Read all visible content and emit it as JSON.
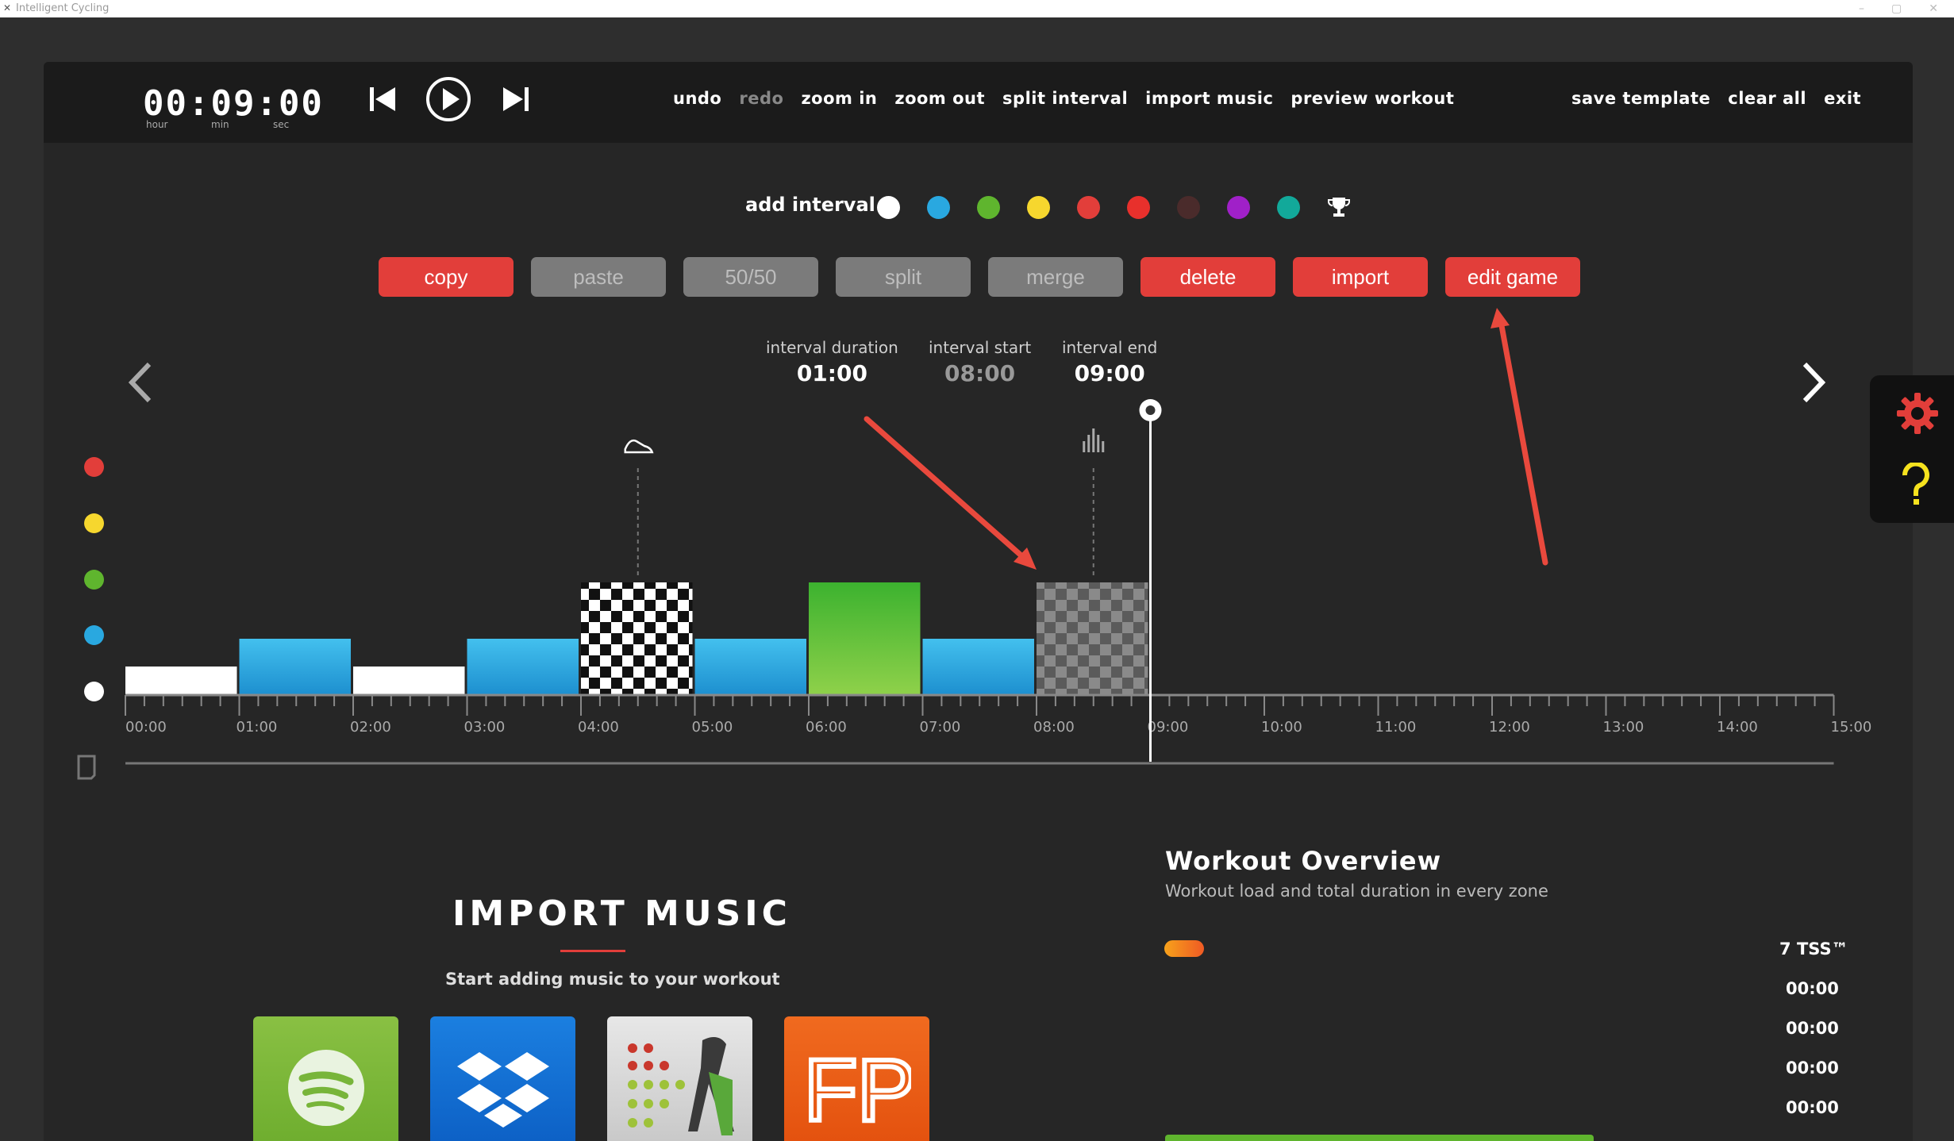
{
  "window": {
    "title": "Intelligent Cycling"
  },
  "timer": {
    "value": "00:09:00",
    "labels": [
      "hour",
      "min",
      "sec"
    ]
  },
  "menu": {
    "undo": "undo",
    "redo": "redo",
    "zoom_in": "zoom in",
    "zoom_out": "zoom out",
    "split_interval": "split interval",
    "import_music": "import music",
    "preview_workout": "preview workout",
    "save_template": "save template",
    "clear_all": "clear all",
    "exit": "exit"
  },
  "add_interval": {
    "label": "add interval",
    "colors": [
      "#ffffff",
      "#29a8e0",
      "#5fb52e",
      "#f6d72e",
      "#e23e3a",
      "#e8302c",
      "#4a2b2b",
      "#a020c8",
      "#12a99a"
    ],
    "trophy_icon": "trophy-icon"
  },
  "buttons": {
    "copy": "copy",
    "paste": "paste",
    "fifty": "50/50",
    "split": "split",
    "merge": "merge",
    "delete": "delete",
    "import": "import",
    "edit_game": "edit game"
  },
  "interval_info": {
    "duration_label": "interval duration",
    "duration": "01:00",
    "start_label": "interval start",
    "start": "08:00",
    "end_label": "interval end",
    "end": "09:00"
  },
  "zone_colors": [
    "#e23e3a",
    "#f6d72e",
    "#5fb52e",
    "#29a8e0",
    "#ffffff"
  ],
  "timeline": {
    "ticks": [
      "00:00",
      "01:00",
      "02:00",
      "03:00",
      "04:00",
      "05:00",
      "06:00",
      "07:00",
      "08:00",
      "09:00",
      "10:00",
      "11:00",
      "12:00",
      "13:00",
      "14:00",
      "15:00"
    ],
    "intervals": [
      {
        "start": 0,
        "end": 1,
        "zone": 1,
        "fill": "white"
      },
      {
        "start": 1,
        "end": 2,
        "zone": 2,
        "fill": "blue"
      },
      {
        "start": 2,
        "end": 3,
        "zone": 1,
        "fill": "white"
      },
      {
        "start": 3,
        "end": 4,
        "zone": 2,
        "fill": "blue"
      },
      {
        "start": 4,
        "end": 5,
        "zone": 3,
        "fill": "checker"
      },
      {
        "start": 5,
        "end": 6,
        "zone": 2,
        "fill": "blue"
      },
      {
        "start": 6,
        "end": 7,
        "zone": 3,
        "fill": "green"
      },
      {
        "start": 7,
        "end": 8,
        "zone": 2,
        "fill": "blue"
      },
      {
        "start": 8,
        "end": 9,
        "zone": 3,
        "fill": "checker-gray"
      }
    ],
    "cursor": 9,
    "markers": [
      {
        "at": 4.5,
        "icon": "shoe-icon"
      },
      {
        "at": 8.5,
        "icon": "bars-icon"
      }
    ]
  },
  "music": {
    "title": "IMPORT MUSIC",
    "subtitle": "Start adding music to your workout",
    "sources": [
      "spotify-icon",
      "dropbox-icon",
      "music-app-icon",
      "fp-icon"
    ],
    "fp_text": "FP"
  },
  "overview": {
    "title": "Workout Overview",
    "subtitle": "Workout load and total duration in every zone",
    "tss_value": "7",
    "tss_unit": "TSS™",
    "zone_times": [
      "00:00",
      "00:00",
      "00:00",
      "00:00"
    ]
  }
}
